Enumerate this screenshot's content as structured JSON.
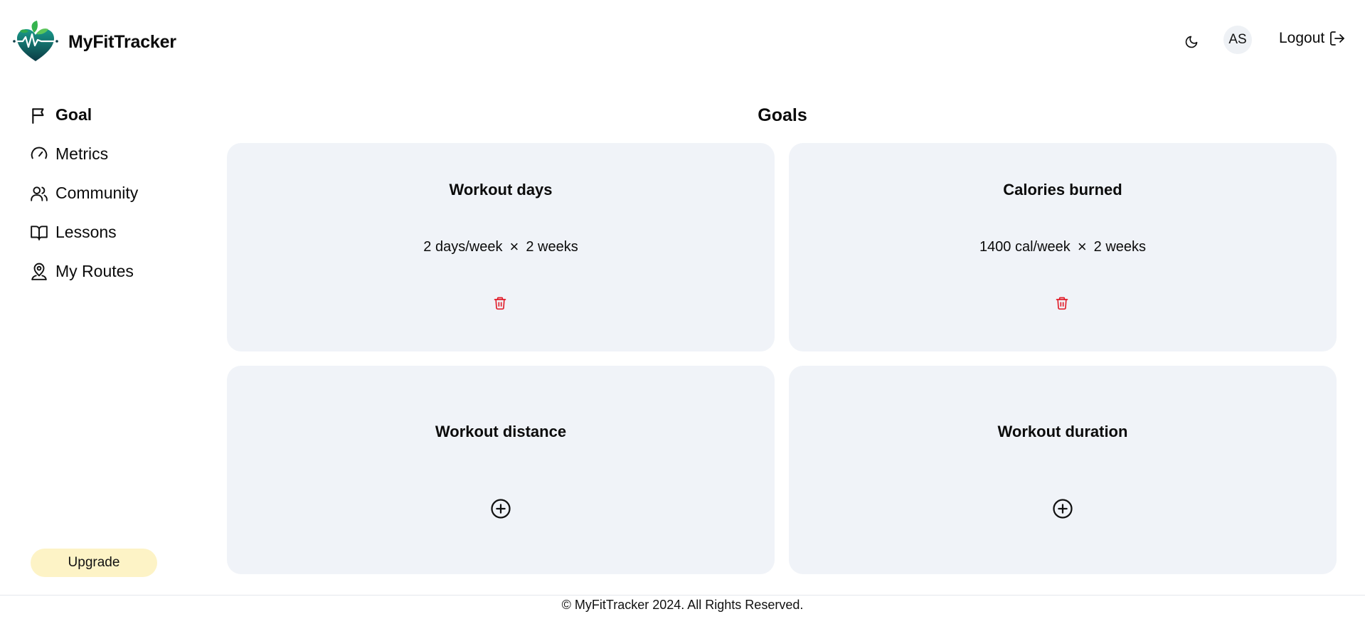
{
  "brand": {
    "name": "MyFitTracker",
    "logo_icon": "heart-leaf-pulse-logo"
  },
  "header": {
    "theme_icon": "moon-icon",
    "avatar_initials": "AS",
    "logout_label": "Logout",
    "logout_icon": "logout-icon"
  },
  "sidebar": {
    "items": [
      {
        "label": "Goal",
        "icon": "flag-icon",
        "active": true
      },
      {
        "label": "Metrics",
        "icon": "gauge-icon",
        "active": false
      },
      {
        "label": "Community",
        "icon": "users-icon",
        "active": false
      },
      {
        "label": "Lessons",
        "icon": "book-open-icon",
        "active": false
      },
      {
        "label": "My Routes",
        "icon": "map-pin-user-icon",
        "active": false
      }
    ],
    "upgrade_label": "Upgrade"
  },
  "main": {
    "title": "Goals",
    "cards": [
      {
        "title": "Workout days",
        "amount": "2 days/week",
        "times": "×",
        "duration": "2 weeks",
        "action_icon": "trash-icon"
      },
      {
        "title": "Calories burned",
        "amount": "1400 cal/week",
        "times": "×",
        "duration": "2 weeks",
        "action_icon": "trash-icon"
      },
      {
        "title": "Workout distance",
        "action_icon": "plus-circle-icon"
      },
      {
        "title": "Workout duration",
        "action_icon": "plus-circle-icon"
      }
    ]
  },
  "colors": {
    "card_bg": "#f0f3f8",
    "delete_red": "#e11d2a",
    "upgrade_bg": "#fdf3c6",
    "logo_green": "#2fa84f",
    "logo_teal": "#0f5d63"
  },
  "footer": {
    "text": "© MyFitTracker 2024. All Rights Reserved."
  }
}
